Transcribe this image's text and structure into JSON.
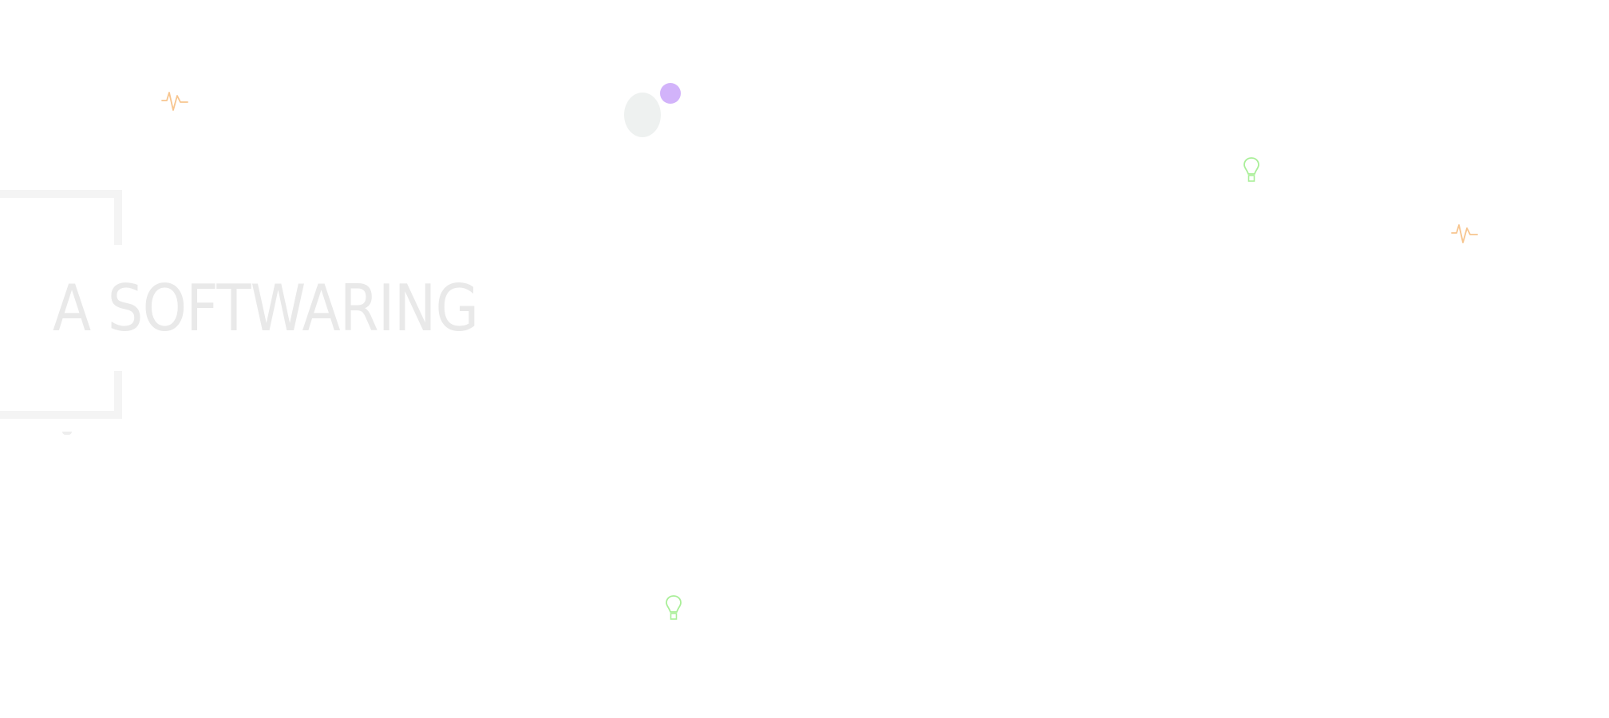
{
  "headline": {
    "text": "A SOFTWARING"
  },
  "decorations": {
    "pulse_icon_color": "#f7c58f",
    "bulb_icon_color": "#a9ef98",
    "dot_color": "#d2b3fa",
    "oval_color": "#eef1f0",
    "frame_color": "#f4f4f4",
    "headline_color": "#e9e9e9"
  }
}
